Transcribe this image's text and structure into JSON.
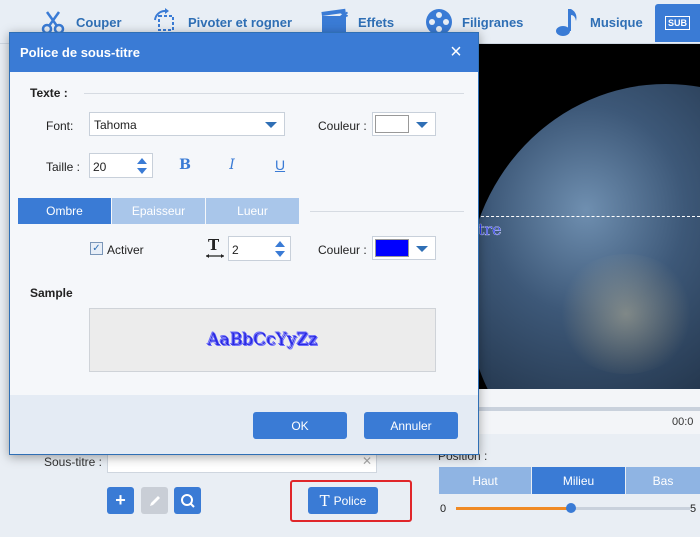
{
  "toolbar": {
    "items": [
      {
        "label": "Couper",
        "icon": "scissors-icon"
      },
      {
        "label": "Pivoter et rogner",
        "icon": "rotate-crop-icon"
      },
      {
        "label": "Effets",
        "icon": "effects-icon"
      },
      {
        "label": "Filigranes",
        "icon": "film-reel-icon"
      },
      {
        "label": "Musique",
        "icon": "music-note-icon"
      }
    ],
    "active_icon_text": "SUB"
  },
  "dialog": {
    "title": "Police de sous-titre",
    "text_section": "Texte :",
    "font_label": "Font:",
    "font_value": "Tahoma",
    "color_label": "Couleur :",
    "text_color": "#ffffff",
    "size_label": "Taille :",
    "size_value": "20",
    "bold": "B",
    "italic": "I",
    "underline": "U",
    "tabs": [
      "Ombre",
      "Epaisseur",
      "Lueur"
    ],
    "active_tab": "Ombre",
    "enable_label": "Activer",
    "enabled": true,
    "outline_value": "2",
    "outline_color_label": "Couleur :",
    "outline_color": "#0000ff",
    "sample_section": "Sample",
    "sample_text": "AaBbCcYyZz",
    "ok_label": "OK",
    "cancel_label": "Annuler"
  },
  "preview": {
    "subtitle_text": "tre",
    "time_text": "00:0"
  },
  "subtitle_panel": {
    "label": "Sous-titre :",
    "input_value": "",
    "police_label": "Police",
    "position_label": "Position :",
    "position_options": [
      "Haut",
      "Milieu",
      "Bas"
    ],
    "position_selected": "Milieu",
    "slider_min": "0",
    "slider_max": "5",
    "slider_fraction": 0.49
  },
  "colors": {
    "accent": "#3a7bd5",
    "highlight": "#e0262a",
    "slider_fill": "#f08a24"
  }
}
